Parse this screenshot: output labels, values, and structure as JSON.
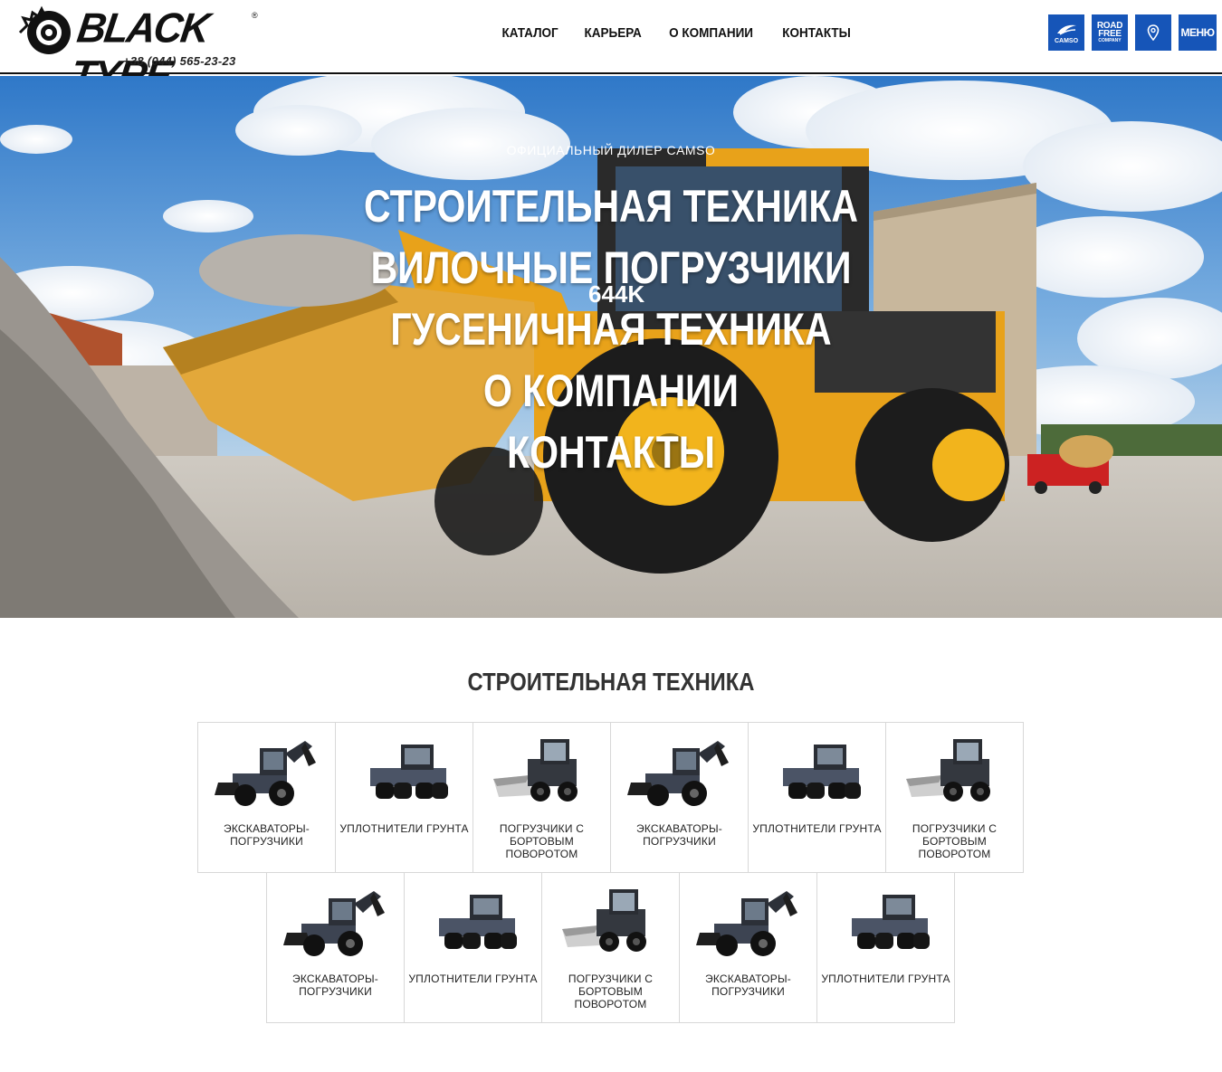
{
  "brand": {
    "name": "BLACK TYRE",
    "reg": "®",
    "phone": "+38 (044) 565-23-23"
  },
  "nav": {
    "items": [
      "КАТАЛОГ",
      "КАРЬЕРА",
      "О КОМПАНИИ",
      "КОНТАКТЫ"
    ]
  },
  "header_buttons": {
    "camso_label": "CAMSO",
    "road_free_line1": "ROAD",
    "road_free_line2": "FREE",
    "road_free_line3": "COMPANY",
    "menu_label": "МЕНЮ"
  },
  "hero": {
    "subtitle": "ОФИЦИАЛЬНЫЙ ДИЛЕР CAMSO",
    "menu": [
      "СТРОИТЕЛЬНАЯ ТЕХНИКА",
      "ВИЛОЧНЫЕ ПОГРУЗЧИКИ",
      "ГУСЕНИЧНАЯ ТЕХНИКА",
      "О КОМПАНИИ",
      "КОНТАКТЫ"
    ],
    "machine_label": "644K"
  },
  "section": {
    "title": "СТРОИТЕЛЬНАЯ ТЕХНИКА"
  },
  "products": [
    {
      "type": "backhoe",
      "label": "ЭКСКАВАТОРЫ-ПОГРУЗЧИКИ"
    },
    {
      "type": "roller",
      "label": "УПЛОТНИТЕЛИ ГРУНТА"
    },
    {
      "type": "skid",
      "label": "ПОГРУЗЧИКИ С БОРТОВЫМ ПОВОРОТОМ"
    },
    {
      "type": "backhoe",
      "label": "ЭКСКАВАТОРЫ-ПОГРУЗЧИКИ"
    },
    {
      "type": "roller",
      "label": "УПЛОТНИТЕЛИ ГРУНТА"
    },
    {
      "type": "skid",
      "label": "ПОГРУЗЧИКИ С БОРТОВЫМ ПОВОРОТОМ"
    },
    {
      "type": "backhoe",
      "label": "ЭКСКАВАТОРЫ-ПОГРУЗЧИКИ"
    },
    {
      "type": "roller",
      "label": "УПЛОТНИТЕЛИ ГРУНТА"
    },
    {
      "type": "skid",
      "label": "ПОГРУЗЧИКИ С БОРТОВЫМ ПОВОРОТОМ"
    },
    {
      "type": "backhoe",
      "label": "ЭКСКАВАТОРЫ-ПОГРУЗЧИКИ"
    },
    {
      "type": "roller",
      "label": "УПЛОТНИТЕЛИ ГРУНТА"
    }
  ],
  "colors": {
    "accent": "#1655b8",
    "machine_yellow": "#e8a21a",
    "sky": "#4a8fd4"
  }
}
